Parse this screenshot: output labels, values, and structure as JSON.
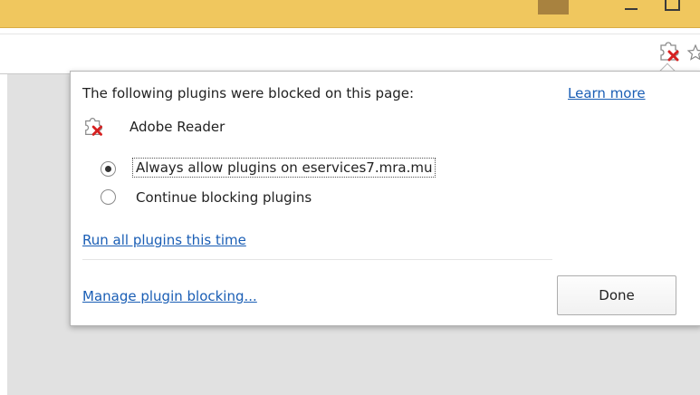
{
  "window": {
    "minimize_icon": "minimize-icon",
    "maximize_icon": "maximize-icon"
  },
  "toolbar": {
    "blocked_plugin_icon": "plugin-blocked-icon",
    "bookmark_icon": "star-icon"
  },
  "bubble": {
    "heading": "The following plugins were blocked on this page:",
    "learn_more": "Learn more",
    "plugins": [
      {
        "name": "Adobe Reader",
        "icon": "plugin-blocked-icon"
      }
    ],
    "options": [
      {
        "label": "Always allow plugins on eservices7.mra.mu",
        "selected": true
      },
      {
        "label": "Continue blocking plugins",
        "selected": false
      }
    ],
    "run_all": "Run all plugins this time",
    "manage": "Manage plugin blocking...",
    "done": "Done"
  },
  "colors": {
    "titlebar": "#f0c75e",
    "link": "#1a5eb5",
    "page_background": "#e1e1e1",
    "blocked_x": "#d62020"
  }
}
